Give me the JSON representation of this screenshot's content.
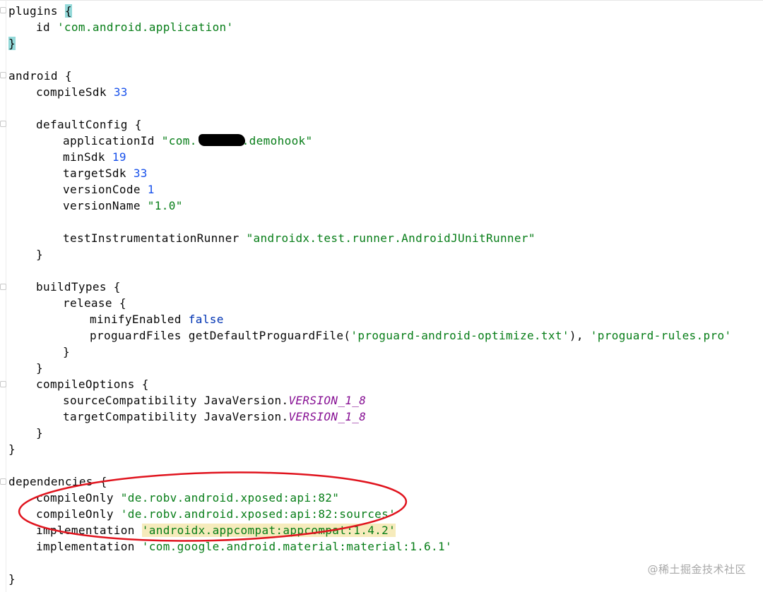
{
  "editor": {
    "lines": {
      "l1": "plugins ",
      "l1_brace": "{",
      "l2_key": "id ",
      "l2_val": "'com.android.application'",
      "l3_brace": "}",
      "l5": "android {",
      "l6_key": "compileSdk ",
      "l6_val": "33",
      "l8": "defaultConfig {",
      "l9_key": "applicationId ",
      "l9_val_a": "\"com.",
      "l9_val_b": ".demohook\"",
      "l10_key": "minSdk ",
      "l10_val": "19",
      "l11_key": "targetSdk ",
      "l11_val": "33",
      "l12_key": "versionCode ",
      "l12_val": "1",
      "l13_key": "versionName ",
      "l13_val": "\"1.0\"",
      "l15_key": "testInstrumentationRunner ",
      "l15_val": "\"androidx.test.runner.AndroidJUnitRunner\"",
      "l16": "}",
      "l18": "buildTypes {",
      "l19": "release {",
      "l20_key": "minifyEnabled ",
      "l20_val": "false",
      "l21_a": "proguardFiles getDefaultProguardFile(",
      "l21_b": "'proguard-android-optimize.txt'",
      "l21_c": "), ",
      "l21_d": "'proguard-rules.pro'",
      "l22": "}",
      "l23": "}",
      "l24": "compileOptions {",
      "l25_key": "sourceCompatibility JavaVersion.",
      "l25_val": "VERSION_1_8",
      "l26_key": "targetCompatibility JavaVersion.",
      "l26_val": "VERSION_1_8",
      "l27": "}",
      "l28": "}",
      "l30": "dependencies {",
      "l31_key": "compileOnly ",
      "l31_val": "\"de.robv.android.xposed:api:82\"",
      "l32_key": "compileOnly ",
      "l32_val": "'de.robv.android.xposed:api:82:sources'",
      "l33_key": "implementation ",
      "l33_val": "'androidx.appcompat:appcompat:1.4.2'",
      "l34_key": "implementation ",
      "l34_val": "'com.google.android.material:material:1.6.1'",
      "l36": "}"
    }
  },
  "watermark": "@稀土掘金技术社区",
  "colors": {
    "string": "#067d17",
    "number": "#1750eb",
    "keyword": "#0033b3",
    "constant": "#871094",
    "annotation_circle": "#e0141e"
  }
}
